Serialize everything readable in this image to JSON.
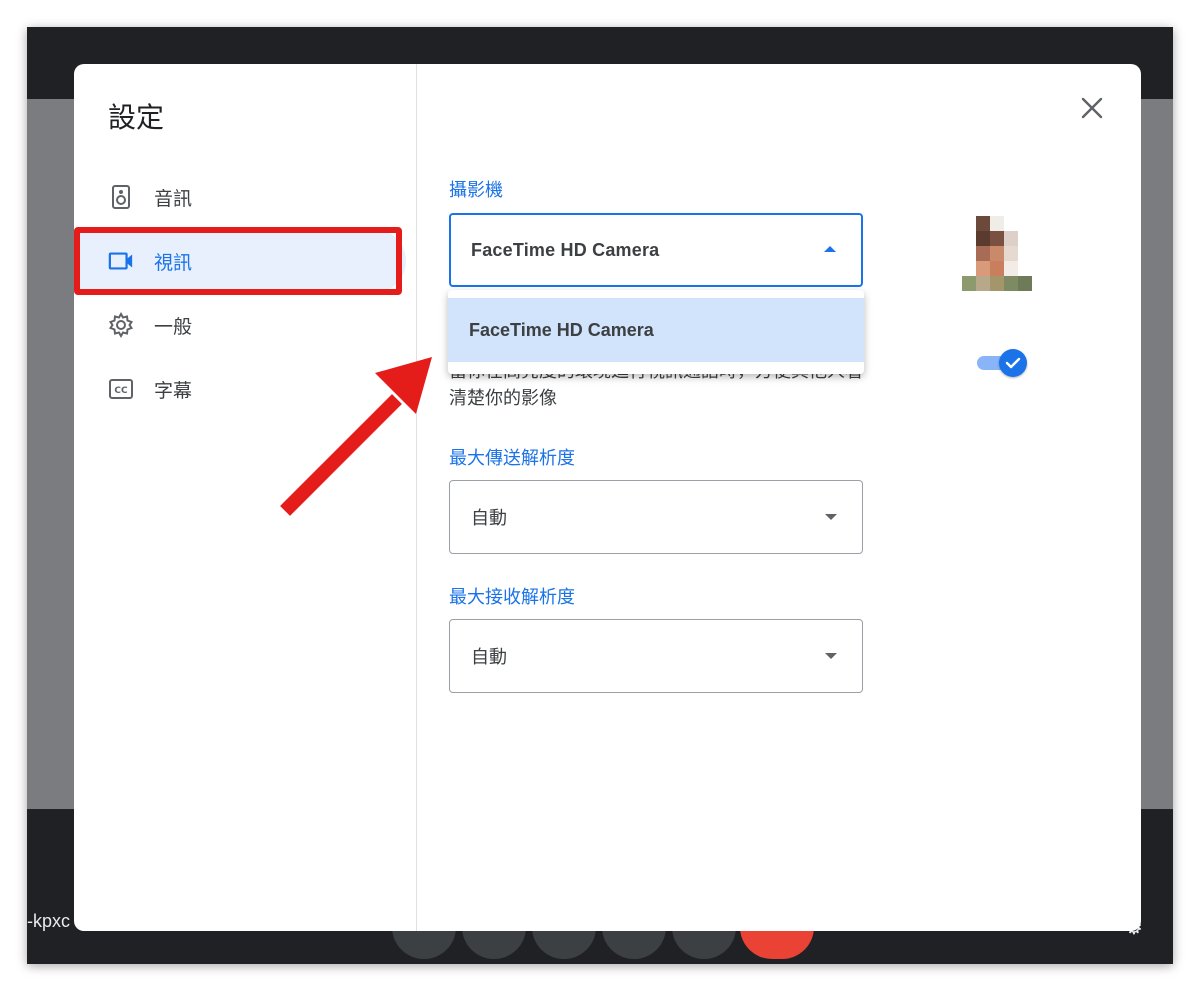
{
  "background": {
    "meeting_code_partial": "-kpxc"
  },
  "dialog": {
    "title": "設定",
    "nav": [
      {
        "label": "音訊",
        "icon": "speaker-icon",
        "active": false
      },
      {
        "label": "視訊",
        "icon": "videocam-icon",
        "active": true
      },
      {
        "label": "一般",
        "icon": "gear-icon",
        "active": false
      },
      {
        "label": "字幕",
        "icon": "closed-caption-icon",
        "active": false
      }
    ],
    "camera": {
      "label": "攝影機",
      "selected": "FaceTime HD Camera",
      "options": [
        "FaceTime HD Camera"
      ]
    },
    "description": "當你在高亮度的環境進行視訊通話時，方便其他人看清楚你的影像",
    "send_resolution": {
      "label": "最大傳送解析度",
      "value": "自動"
    },
    "receive_resolution": {
      "label": "最大接收解析度",
      "value": "自動"
    },
    "toggle_on": true
  },
  "colors": {
    "accent": "#1a73e8",
    "highlight_annotation": "#e41d1b",
    "active_nav_bg": "#e8f0fe",
    "menu_selected_bg": "#d2e3fc"
  }
}
